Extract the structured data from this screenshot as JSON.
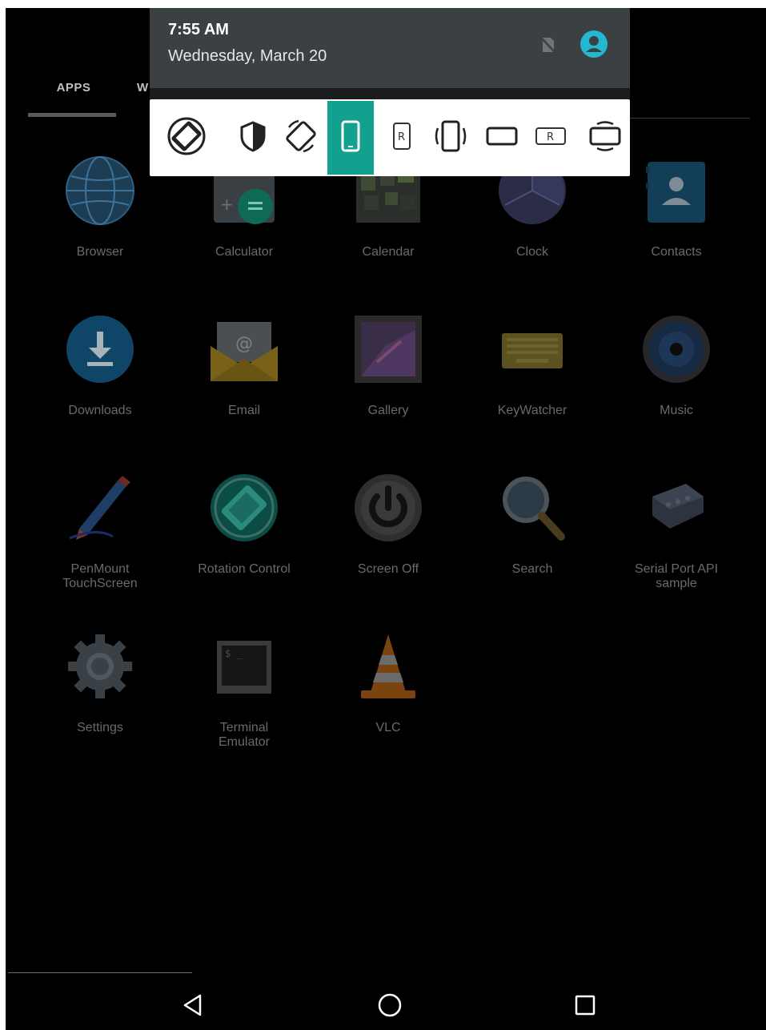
{
  "tabs": [
    {
      "label": "APPS"
    },
    {
      "label": "W"
    }
  ],
  "notification": {
    "time": "7:55 AM",
    "date": "Wednesday, March 20"
  },
  "rotation_panel": {
    "accent_color": "#12a08f",
    "buttons": [
      {
        "icon": "auto-rotate-icon"
      },
      {
        "icon": "shield-icon"
      },
      {
        "icon": "rotate-icon"
      },
      {
        "icon": "portrait-icon",
        "selected": true
      },
      {
        "icon": "reverse-portrait-icon",
        "text": "R"
      },
      {
        "icon": "sensor-portrait-icon"
      },
      {
        "icon": "landscape-icon"
      },
      {
        "icon": "reverse-landscape-icon",
        "text": "R"
      },
      {
        "icon": "sensor-landscape-icon"
      }
    ]
  },
  "apps": [
    {
      "label": "Browser"
    },
    {
      "label": "Calculator"
    },
    {
      "label": "Calendar"
    },
    {
      "label": "Clock"
    },
    {
      "label": "Contacts"
    },
    {
      "label": "Downloads"
    },
    {
      "label": "Email"
    },
    {
      "label": "Gallery"
    },
    {
      "label": "KeyWatcher"
    },
    {
      "label": "Music"
    },
    {
      "label": "PenMount\nTouchScreen"
    },
    {
      "label": "Rotation Control"
    },
    {
      "label": "Screen Off"
    },
    {
      "label": "Search"
    },
    {
      "label": "Serial Port API\nsample"
    },
    {
      "label": "Settings"
    },
    {
      "label": "Terminal\nEmulator"
    },
    {
      "label": "VLC"
    }
  ],
  "nav": [
    "back-icon",
    "home-icon",
    "recents-icon"
  ]
}
